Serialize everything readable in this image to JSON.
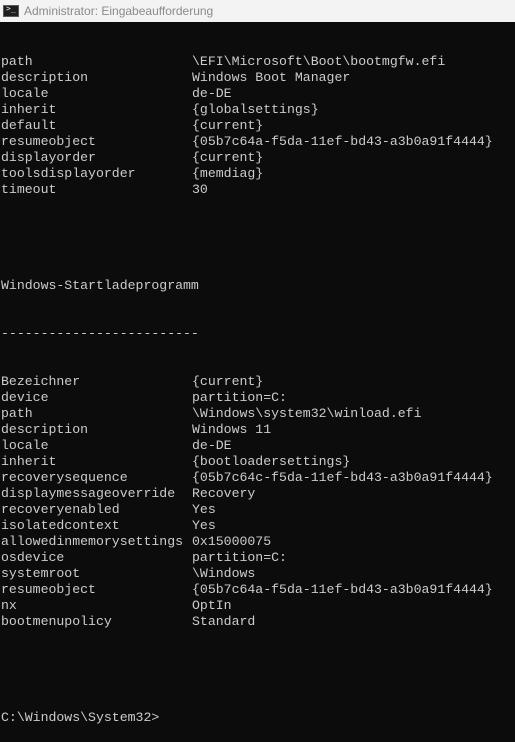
{
  "window": {
    "title": "Administrator: Eingabeaufforderung",
    "icon": "cmd-icon"
  },
  "block1": [
    {
      "key": "path",
      "value": "\\EFI\\Microsoft\\Boot\\bootmgfw.efi"
    },
    {
      "key": "description",
      "value": "Windows Boot Manager"
    },
    {
      "key": "locale",
      "value": "de-DE"
    },
    {
      "key": "inherit",
      "value": "{globalsettings}"
    },
    {
      "key": "default",
      "value": "{current}"
    },
    {
      "key": "resumeobject",
      "value": "{05b7c64a-f5da-11ef-bd43-a3b0a91f4444}"
    },
    {
      "key": "displayorder",
      "value": "{current}"
    },
    {
      "key": "toolsdisplayorder",
      "value": "{memdiag}"
    },
    {
      "key": "timeout",
      "value": "30"
    }
  ],
  "section2": {
    "heading": "Windows-Startladeprogramm",
    "underline": "-------------------------"
  },
  "block2": [
    {
      "key": "Bezeichner",
      "value": "{current}"
    },
    {
      "key": "device",
      "value": "partition=C:"
    },
    {
      "key": "path",
      "value": "\\Windows\\system32\\winload.efi"
    },
    {
      "key": "description",
      "value": "Windows 11"
    },
    {
      "key": "locale",
      "value": "de-DE"
    },
    {
      "key": "inherit",
      "value": "{bootloadersettings}"
    },
    {
      "key": "recoverysequence",
      "value": "{05b7c64c-f5da-11ef-bd43-a3b0a91f4444}"
    },
    {
      "key": "displaymessageoverride",
      "value": "Recovery"
    },
    {
      "key": "recoveryenabled",
      "value": "Yes"
    },
    {
      "key": "isolatedcontext",
      "value": "Yes"
    },
    {
      "key": "allowedinmemorysettings",
      "value": "0x15000075"
    },
    {
      "key": "osdevice",
      "value": "partition=C:"
    },
    {
      "key": "systemroot",
      "value": "\\Windows"
    },
    {
      "key": "resumeobject",
      "value": "{05b7c64a-f5da-11ef-bd43-a3b0a91f4444}"
    },
    {
      "key": "nx",
      "value": "OptIn"
    },
    {
      "key": "bootmenupolicy",
      "value": "Standard"
    }
  ],
  "prompt": "C:\\Windows\\System32>",
  "colors": {
    "background": "#0c0c0c",
    "text": "#cccccc",
    "titlebar": "#f3f3f3",
    "title_text": "#8a8a8a"
  }
}
